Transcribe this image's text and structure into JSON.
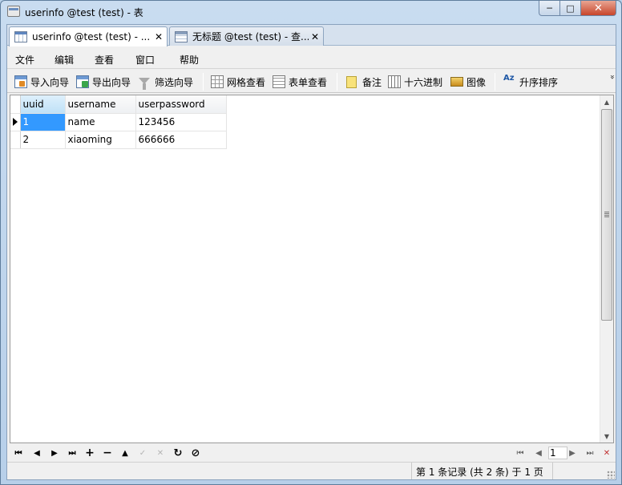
{
  "window": {
    "title": "userinfo @test (test) - 表",
    "minimize": "─",
    "maximize": "□",
    "close": "✕"
  },
  "tabs": [
    {
      "label": "userinfo @test (test) - ...",
      "close": "✕",
      "icon": "table-icon",
      "active": true
    },
    {
      "label": "无标题 @test (test) - 查...",
      "close": "✕",
      "icon": "query-icon",
      "active": false
    }
  ],
  "menu": [
    "文件",
    "编辑",
    "查看",
    "窗口",
    "帮助"
  ],
  "toolbar": {
    "import_wizard": "导入向导",
    "export_wizard": "导出向导",
    "filter_wizard": "筛选向导",
    "grid_view": "网格查看",
    "form_view": "表单查看",
    "memo": "备注",
    "hex": "十六进制",
    "image": "图像",
    "sort_asc": "升序排序",
    "sort_icon_text": "Az",
    "more": "»"
  },
  "grid": {
    "columns": [
      "uuid",
      "username",
      "userpassword"
    ],
    "rows": [
      {
        "uuid": "1",
        "username": "name",
        "userpassword": "123456"
      },
      {
        "uuid": "2",
        "username": "xiaoming",
        "userpassword": "666666"
      }
    ],
    "selected_row": 0
  },
  "navigator": {
    "first": "⏮",
    "prev": "◀",
    "next": "▶",
    "last": "⏭",
    "add": "+",
    "delete": "−",
    "up": "▲",
    "apply": "✓",
    "cancel": "✕",
    "refresh": "↻",
    "stop": "⊘",
    "page": "1"
  },
  "status": {
    "record_text": "第 1 条记录 (共 2 条) 于 1 页"
  },
  "colors": {
    "selection": "#3399ff",
    "title_gradient": "#c9dcf0"
  }
}
